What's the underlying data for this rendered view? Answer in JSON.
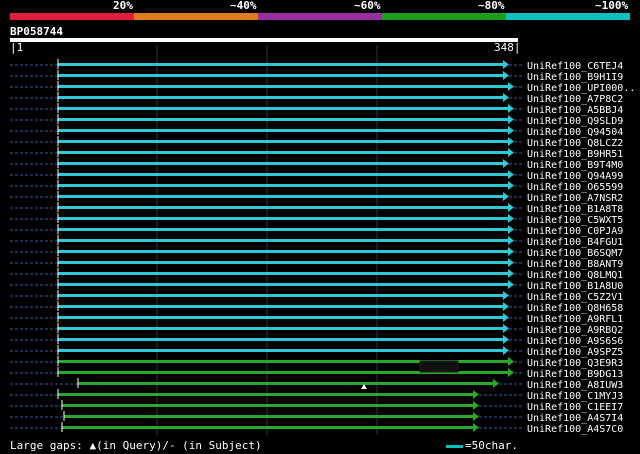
{
  "legend": {
    "labels": [
      "20%",
      "~40%",
      "~60%",
      "~80%",
      "~100%"
    ],
    "colors": [
      "#e01e3c",
      "#e07a1e",
      "#9a2ea0",
      "#1aa01a",
      "#10c0c0"
    ]
  },
  "query": {
    "name": "BP058744",
    "start_label": "1",
    "end_label": "348"
  },
  "colors": {
    "cyan": "#2ec8d6",
    "green": "#2aa82a",
    "dashed": "#3a5aa0",
    "grid": "#333333"
  },
  "hits": [
    {
      "name": "UniRef100_C6TEJ4",
      "color": "cyan"
    },
    {
      "name": "UniRef100_B9H1I9",
      "color": "cyan"
    },
    {
      "name": "UniRef100_UPI000..",
      "color": "cyan"
    },
    {
      "name": "UniRef100_A7P8C2",
      "color": "cyan"
    },
    {
      "name": "UniRef100_A5BBJ4",
      "color": "cyan"
    },
    {
      "name": "UniRef100_Q9SLD9",
      "color": "cyan"
    },
    {
      "name": "UniRef100_Q94504",
      "color": "cyan"
    },
    {
      "name": "UniRef100_Q8LCZ2",
      "color": "cyan"
    },
    {
      "name": "UniRef100_B9HR51",
      "color": "cyan"
    },
    {
      "name": "UniRef100_B9T4M0",
      "color": "cyan"
    },
    {
      "name": "UniRef100_Q94A99",
      "color": "cyan"
    },
    {
      "name": "UniRef100_O65599",
      "color": "cyan"
    },
    {
      "name": "UniRef100_A7NSR2",
      "color": "cyan"
    },
    {
      "name": "UniRef100_B1A8T8",
      "color": "cyan"
    },
    {
      "name": "UniRef100_C5WXT5",
      "color": "cyan"
    },
    {
      "name": "UniRef100_C0PJA9",
      "color": "cyan"
    },
    {
      "name": "UniRef100_B4FGU1",
      "color": "cyan"
    },
    {
      "name": "UniRef100_B6SQM7",
      "color": "cyan"
    },
    {
      "name": "UniRef100_B8ANT9",
      "color": "cyan"
    },
    {
      "name": "UniRef100_Q8LMQ1",
      "color": "cyan"
    },
    {
      "name": "UniRef100_B1A8U0",
      "color": "cyan"
    },
    {
      "name": "UniRef100_C5Z2V1",
      "color": "cyan"
    },
    {
      "name": "UniRef100_Q8H658",
      "color": "cyan"
    },
    {
      "name": "UniRef100_A9RFL1",
      "color": "cyan"
    },
    {
      "name": "UniRef100_A9RBQ2",
      "color": "cyan"
    },
    {
      "name": "UniRef100_A9S6S6",
      "color": "cyan"
    },
    {
      "name": "UniRef100_A9SPZ5",
      "color": "cyan"
    },
    {
      "name": "UniRef100_Q3E9R3",
      "color": "green"
    },
    {
      "name": "UniRef100_B9DG13",
      "color": "green"
    },
    {
      "name": "UniRef100_A8IUW3",
      "color": "green"
    },
    {
      "name": "UniRef100_C1MYJ3",
      "color": "green"
    },
    {
      "name": "UniRef100_C1EEI7",
      "color": "green"
    },
    {
      "name": "UniRef100_A4S7I4",
      "color": "green"
    },
    {
      "name": "UniRef100_A4S7C0",
      "color": "green"
    }
  ],
  "footer": {
    "gaps_text": "Large gaps: ▲(in Query)/- (in Subject)",
    "scale_text": "=50char."
  }
}
